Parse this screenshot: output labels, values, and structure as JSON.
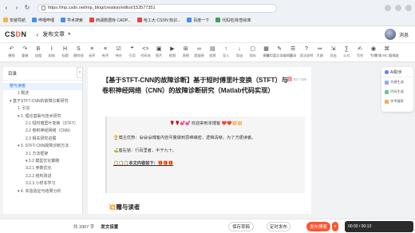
{
  "browser": {
    "url": "https://mp.csdn.net/mp_blog/creation/editor/153577351",
    "bookmarks": [
      {
        "label": "安装导航",
        "icon": "folder-icon"
      },
      {
        "label": "哔哩哔哩",
        "icon": "site-icon"
      },
      {
        "label": "学术搜索",
        "icon": "site-icon"
      },
      {
        "label": "西湖数据库 CADP...",
        "icon": "site-icon"
      },
      {
        "label": "哈工大·CSDN 知识...",
        "icon": "site-icon"
      },
      {
        "label": "百度一下",
        "icon": "site-icon"
      },
      {
        "label": "代码检测/查综率",
        "icon": "site-icon"
      }
    ]
  },
  "header": {
    "logo_prefix": "CS",
    "logo_mark": "D",
    "logo_suffix": "N",
    "page_title": "发布文章",
    "user_label": "消息"
  },
  "toolbar": {
    "items": [
      {
        "label": "撤销",
        "icon": "↶"
      },
      {
        "label": "重做",
        "icon": "↷"
      },
      {
        "label": "加粗",
        "icon": "B"
      },
      {
        "label": "斜体",
        "icon": "I"
      },
      {
        "label": "标题",
        "icon": "H"
      },
      {
        "label": "删除线",
        "icon": "S"
      },
      {
        "label": "无序",
        "icon": "≡"
      },
      {
        "label": "有序",
        "icon": "≡"
      },
      {
        "label": "待办",
        "icon": "☑"
      },
      {
        "label": "引用",
        "icon": "❝"
      },
      {
        "label": "代码块",
        "icon": "<>"
      },
      {
        "label": "图片",
        "icon": "▣"
      },
      {
        "label": "视频",
        "icon": "▶"
      },
      {
        "label": "表格",
        "icon": "⊞"
      },
      {
        "label": "超链接",
        "icon": "∞"
      },
      {
        "label": "投票",
        "icon": "▤"
      },
      {
        "label": "导入",
        "icon": "↑"
      },
      {
        "label": "导出",
        "icon": "↓"
      },
      {
        "label": "保存",
        "icon": "▢"
      },
      {
        "label": "模版",
        "icon": "▦"
      },
      {
        "label": "使用富文本编辑器",
        "icon": "✎"
      },
      {
        "label": "目录",
        "icon": "☰"
      },
      {
        "label": "语法说明",
        "icon": "?"
      },
      {
        "label": "大纲",
        "icon": "≔"
      },
      {
        "label": "导出",
        "icon": "⇲"
      },
      {
        "label": "公式",
        "icon": "∑"
      },
      {
        "label": "写作",
        "icon": "✍"
      },
      {
        "label": "专辑",
        "icon": "◉"
      },
      {
        "label": "专辑 MC 编辑器",
        "icon": "⌘"
      }
    ]
  },
  "outline": {
    "title": "目录",
    "items": [
      {
        "label": "赠与读者",
        "level": 1,
        "active": true
      },
      {
        "label": "1 概述",
        "level": 2,
        "active": false
      },
      {
        "label": "▾ 基于STFT-CNN的故障诊断研究",
        "level": 1,
        "active": false
      },
      {
        "label": "1. 引言",
        "level": 2,
        "active": false
      },
      {
        "label": "▾ 2. 理论基础与技术研究",
        "level": 2,
        "active": false
      },
      {
        "label": "2.1 短时傅里叶变换（STFT）",
        "level": 3,
        "active": false
      },
      {
        "label": "2.2 卷积神经网络（CNN）",
        "level": 3,
        "active": false
      },
      {
        "label": "2.3 相关研究进展",
        "level": 3,
        "active": false
      },
      {
        "label": "▾ 3. STFT-CNN故障诊断方法",
        "level": 2,
        "active": false
      },
      {
        "label": "3.1 方法框架",
        "level": 3,
        "active": false
      },
      {
        "label": "▾ 3.2 模型优化策略",
        "level": 3,
        "active": false
      },
      {
        "label": "3.2.1 参数优化",
        "level": 3,
        "active": false
      },
      {
        "label": "3.2.2 结构改进",
        "level": 3,
        "active": false
      },
      {
        "label": "3.2.3 小样本学习",
        "level": 3,
        "active": false
      },
      {
        "label": "▾ 4. 实验验证与结果分析",
        "level": 2,
        "active": false
      }
    ]
  },
  "editor": {
    "title": "【基于STFT-CNN的故障诊断】基于短时傅里叶变换（STFT）与卷积神经网络（CNN）的故障诊断研究（Matlab代码实现）",
    "char_count": "83 / 100",
    "quote_lines": [
      "🌹🌹💕💕 欢迎来到本博客 ❤️❤️💥💥",
      "🏆博主优势：😄😄😄博客内容尽量做到思维缜密，逻辑清晰，为了方便读者。",
      "⛳座右铭：行百里者，半于九十。",
      "📋📋📋本文内容如下：🎁🎁🎁"
    ],
    "section_heading": "💥赠与读者"
  },
  "ai_panel": {
    "title": "AI助手",
    "items": [
      "大纲生成",
      "代码生成",
      "学术搜索"
    ]
  },
  "footer": {
    "word_count": "共 3307 字",
    "content_settings": "发文设置",
    "save_draft": "保存草稿",
    "timed_publish": "定时发布",
    "publish": "发布博客",
    "player_time": "00:00 / 00:13"
  }
}
